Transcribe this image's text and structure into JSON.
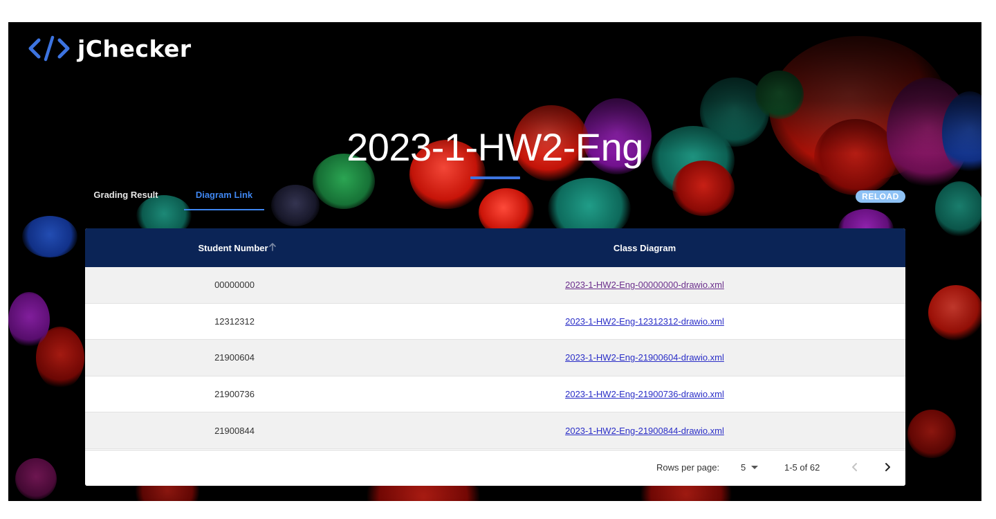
{
  "app": {
    "logo_icon": "code-brackets-icon",
    "name": "jChecker",
    "brand_color": "#3d74e0"
  },
  "page": {
    "title": "2023-1-HW2-Eng"
  },
  "tabs": [
    {
      "label": "Grading Result",
      "active": false
    },
    {
      "label": "Diagram Link",
      "active": true
    }
  ],
  "actions": {
    "reload_label": "RELOAD"
  },
  "table": {
    "columns": [
      {
        "label": "Student Number",
        "sort_icon": "sort-arrow-icon"
      },
      {
        "label": "Class Diagram"
      }
    ],
    "rows": [
      {
        "student_number": "00000000",
        "diagram": "2023-1-HW2-Eng-00000000-drawio.xml",
        "visited": true
      },
      {
        "student_number": "12312312",
        "diagram": "2023-1-HW2-Eng-12312312-drawio.xml",
        "visited": false
      },
      {
        "student_number": "21900604",
        "diagram": "2023-1-HW2-Eng-21900604-drawio.xml",
        "visited": false
      },
      {
        "student_number": "21900736",
        "diagram": "2023-1-HW2-Eng-21900736-drawio.xml",
        "visited": false
      },
      {
        "student_number": "21900844",
        "diagram": "2023-1-HW2-Eng-21900844-drawio.xml",
        "visited": false
      }
    ],
    "header_color": "#0b2456"
  },
  "pagination": {
    "rows_per_page_label": "Rows per page:",
    "rows_per_page_value": "5",
    "range_text": "1-5 of 62",
    "prev_icon": "chevron-left-icon",
    "next_icon": "chevron-right-icon"
  }
}
